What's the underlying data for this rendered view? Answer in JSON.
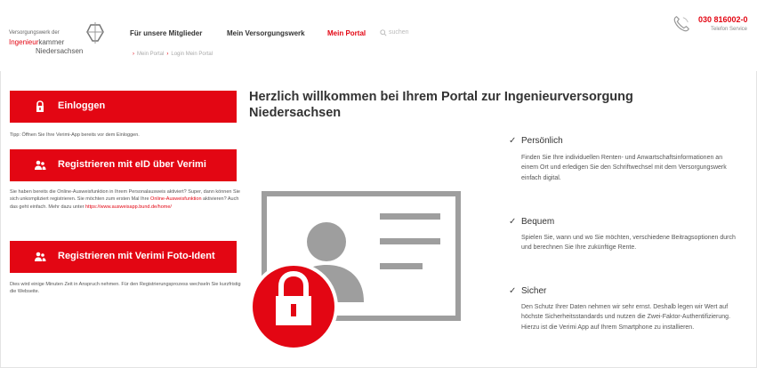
{
  "logo": {
    "line1": "Versorgungswerk der",
    "line2_red": "Ingenieur",
    "line2_rest": "kammer",
    "line3": "Niedersachsen"
  },
  "nav": {
    "items": [
      {
        "label": "Für unsere Mitglieder"
      },
      {
        "label": "Mein Versorgungswerk"
      },
      {
        "label": "Mein Portal",
        "active": true
      }
    ],
    "search_placeholder": "suchen"
  },
  "breadcrumb": [
    "Mein Portal",
    "Login Mein Portal"
  ],
  "phone": {
    "number": "030 816002-0",
    "label": "Telefon Service"
  },
  "left": {
    "login_button": "Einloggen",
    "tip": "Tipp: Öffnen Sie Ihre Verimi-App bereits vor dem Einloggen.",
    "verimi_eid_button": "Registrieren mit eID über Verimi",
    "eid_note": "Sie haben bereits die Online-Ausweisfunktion in Ihrem Personalausweis aktiviert? Super, dann können Sie sich unkompliziert registrieren. Sie möchten zum ersten Mal Ihre ",
    "eid_note_link1": "Online-Ausweisfunktion",
    "eid_note_mid": " aktivieren? Auch das geht einfach. Mehr dazu unter ",
    "eid_note_link2": "https://www.ausweisapp.bund.de/home/",
    "fotoident_button": "Registrieren mit Verimi Foto-Ident",
    "foto_note": "Dies wird einige Minuten Zeit in Anspruch nehmen. Für den Registrierungsprozess wechseln Sie kurzfristig die Webseite."
  },
  "main": {
    "title": "Herzlich willkommen bei Ihrem Portal zur Ingenieurversorgung Niedersachsen",
    "benefits": [
      {
        "title": "Persönlich",
        "text": "Finden Sie Ihre individuellen Renten- und Anwartschaftsinformationen an einem Ort und erledigen Sie den Schriftwechsel mit dem Versorgungswerk einfach digital."
      },
      {
        "title": "Bequem",
        "text": "Spielen Sie, wann und wo Sie möchten, verschiedene Beitragsoptionen durch und berechnen Sie Ihre zukünftige Rente."
      },
      {
        "title": "Sicher",
        "text": "Den Schutz Ihrer Daten nehmen wir sehr ernst. Deshalb legen wir Wert auf höchste Sicherheitsstandards und nutzen die Zwei-Faktor-Authentifizierung. Hierzu ist die Verimi App auf Ihrem Smartphone zu installieren."
      }
    ]
  },
  "colors": {
    "accent": "#e30613",
    "text": "#333333",
    "illustration_gray": "#9e9e9e"
  },
  "icons": {
    "login": "lock-icon",
    "register": "users-icon",
    "phone": "phone-icon",
    "search": "search-icon",
    "check": "check-icon"
  }
}
